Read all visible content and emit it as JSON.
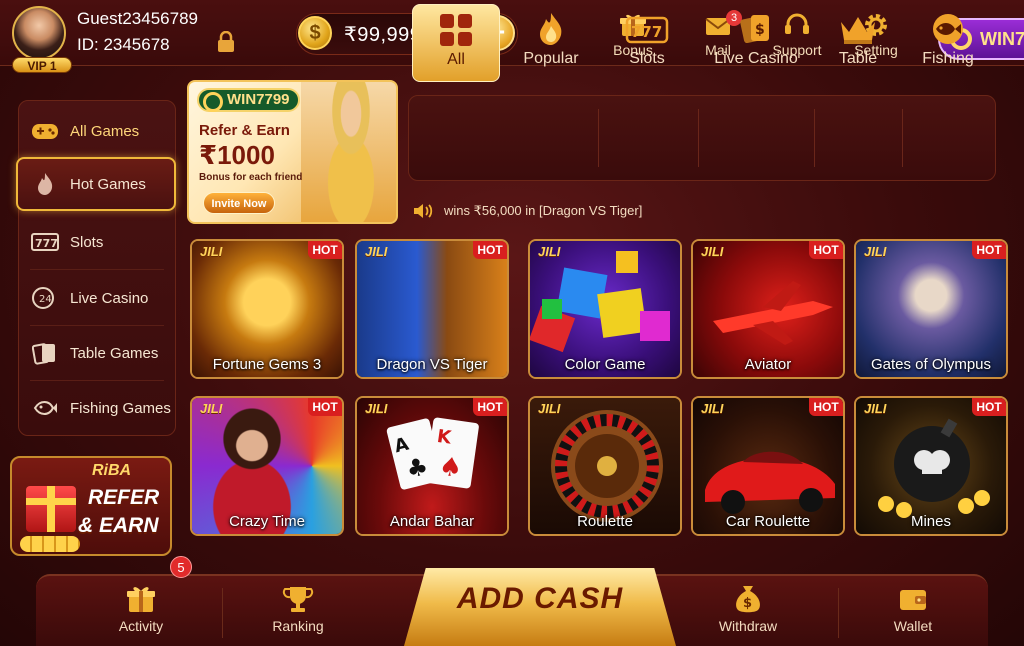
{
  "user": {
    "name": "Guest23456789",
    "id_label": "ID: 2345678",
    "vip": "VIP 1"
  },
  "wallet": {
    "balance": "₹99,999.99",
    "coin_symbol": "$",
    "add_symbol": "+"
  },
  "top_nav": [
    {
      "label": "Bonus",
      "icon": "gift-icon"
    },
    {
      "label": "Mail",
      "icon": "mail-icon",
      "badge": "3"
    },
    {
      "label": "Support",
      "icon": "headset-icon"
    },
    {
      "label": "Setting",
      "icon": "gear-icon"
    }
  ],
  "brand_top": "WIN7",
  "sidebar": {
    "items": [
      {
        "label": "All Games",
        "icon": "gamepad-icon"
      },
      {
        "label": "Hot Games",
        "icon": "flame-icon"
      },
      {
        "label": "Slots",
        "icon": "slots-icon"
      },
      {
        "label": "Live Casino",
        "icon": "live-24h-icon"
      },
      {
        "label": "Table Games",
        "icon": "cards-icon"
      },
      {
        "label": "Fishing Games",
        "icon": "fish-icon"
      }
    ]
  },
  "refer_left": {
    "tag": "RiBA",
    "line1": "REFER",
    "line2": "& EARN"
  },
  "promo": {
    "brand": "WIN7799",
    "title": "Refer & Earn",
    "amount": "₹1000",
    "subtitle": "Bonus for each friend",
    "button": "Invite Now"
  },
  "categories": [
    {
      "label": "All",
      "icon": "grid-icon"
    },
    {
      "label": "Popular",
      "icon": "flame-icon"
    },
    {
      "label": "Slots",
      "icon": "slots-777-icon"
    },
    {
      "label": "Live Casino",
      "icon": "cards-dollar-icon"
    },
    {
      "label": "Table",
      "icon": "crown-icon"
    },
    {
      "label": "Fishing",
      "icon": "fish-icon"
    }
  ],
  "ticker": {
    "text": "wins ₹56,000 in [Dragon VS Tiger]"
  },
  "games": [
    {
      "name": "Fortune Gems 3",
      "provider": "JILI",
      "hot": "HOT"
    },
    {
      "name": "Dragon VS Tiger",
      "provider": "JILI",
      "hot": "HOT"
    },
    {
      "name": "Color Game",
      "provider": "JILI",
      "hot": ""
    },
    {
      "name": "Aviator",
      "provider": "JILI",
      "hot": "HOT"
    },
    {
      "name": "Gates of Olympus",
      "provider": "JILI",
      "hot": "HOT"
    },
    {
      "name": "Crazy Time",
      "provider": "JILI",
      "hot": "HOT"
    },
    {
      "name": "Andar Bahar",
      "provider": "JILI",
      "hot": "HOT"
    },
    {
      "name": "Roulette",
      "provider": "JILI",
      "hot": ""
    },
    {
      "name": "Car Roulette",
      "provider": "JILI",
      "hot": "HOT"
    },
    {
      "name": "Mines",
      "provider": "JILI",
      "hot": "HOT"
    }
  ],
  "bottom_nav": {
    "activity": {
      "label": "Activity",
      "badge": "5"
    },
    "ranking": {
      "label": "Ranking"
    },
    "add_cash": "ADD CASH",
    "withdraw": {
      "label": "Withdraw"
    },
    "wallet": {
      "label": "Wallet"
    }
  },
  "colors": {
    "background": "#3a0b0b",
    "accent_gold": "#f0b93a",
    "hot_red": "#d91f1f",
    "promo_purple": "#9a2dd6"
  }
}
